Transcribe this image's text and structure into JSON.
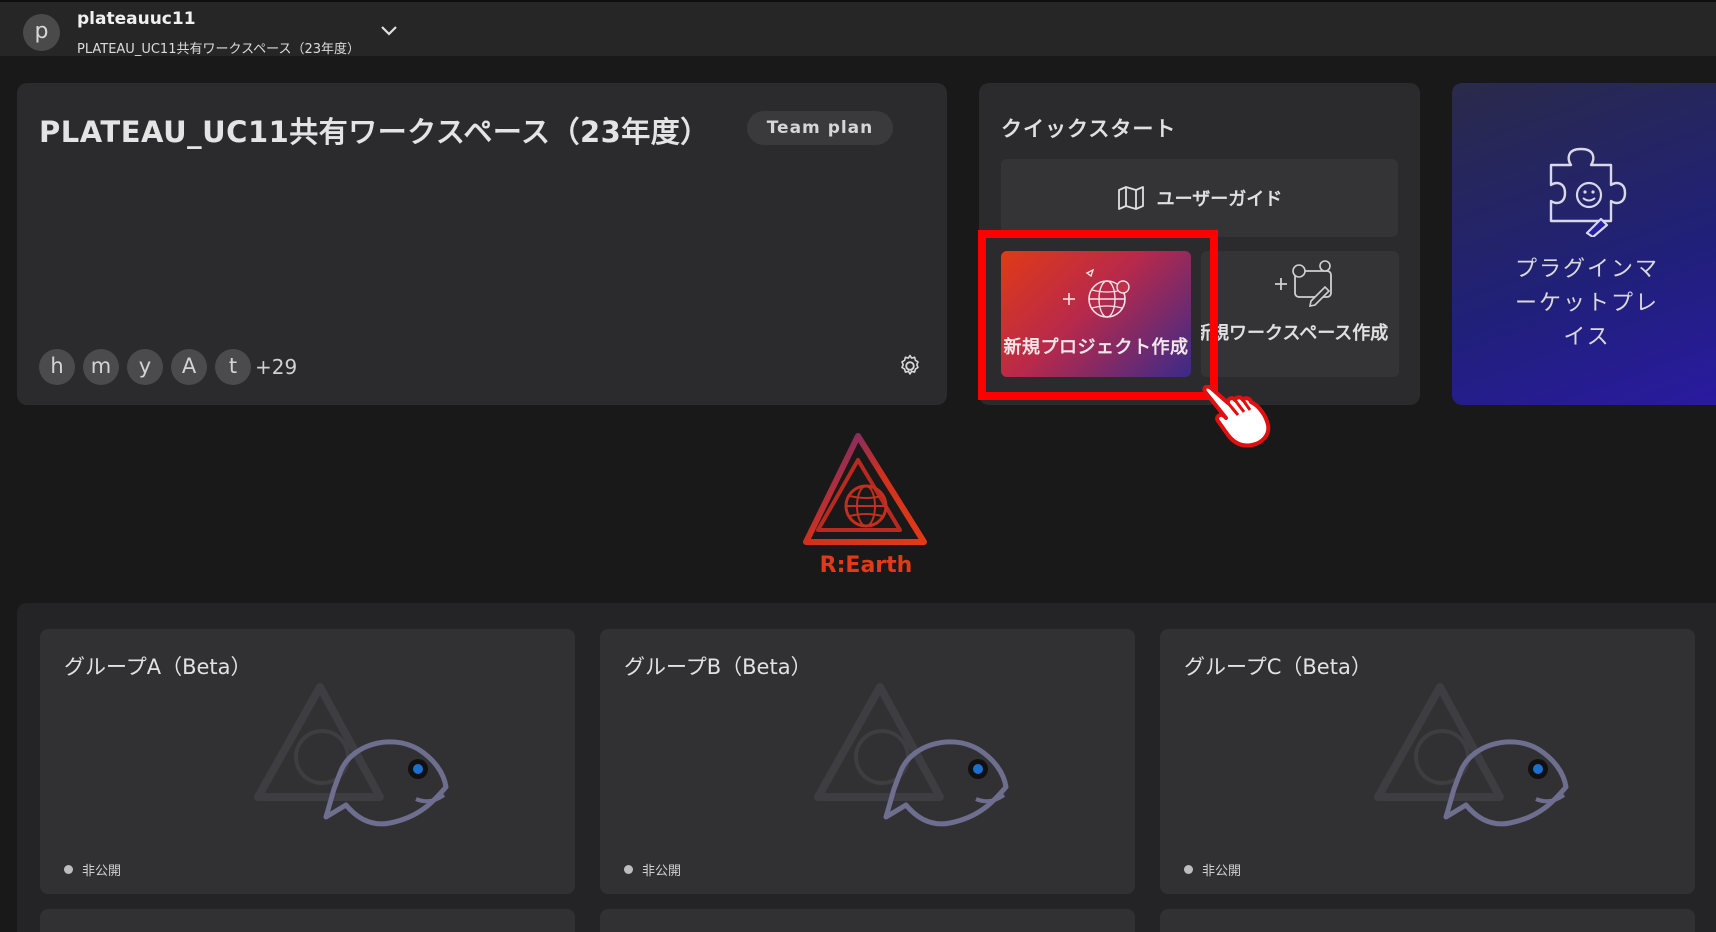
{
  "header": {
    "avatar_letter": "p",
    "username": "plateauuc11",
    "workspace_name": "PLATEAU_UC11共有ワークスペース（23年度）"
  },
  "workspace": {
    "title": "PLATEAU_UC11共有ワークスペース（23年度）",
    "plan": "Team plan",
    "members": [
      "h",
      "m",
      "y",
      "A",
      "t"
    ],
    "more_members": "+29"
  },
  "quickstart": {
    "title": "クイックスタート",
    "user_guide": "ユーザーガイド",
    "new_project": "新規プロジェクト作成",
    "new_workspace": "新規ワークスペース作成"
  },
  "plugin": {
    "label": "プラグインマーケットプレイス"
  },
  "logo": {
    "text": "R:Earth"
  },
  "projects": [
    {
      "title": "グループA（Beta）",
      "status": "非公開"
    },
    {
      "title": "グループB（Beta）",
      "status": "非公開"
    },
    {
      "title": "グループC（Beta）",
      "status": "非公開"
    }
  ],
  "colors": {
    "highlight": "#ff0000",
    "accent_orange": "#e23a16",
    "accent_blue": "#2a1aa0"
  }
}
